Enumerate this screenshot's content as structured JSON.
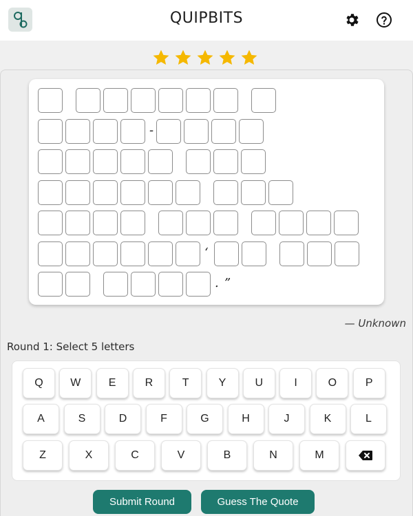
{
  "header": {
    "title": "QUIPBITS",
    "logo_icon": "qb-logo",
    "settings_icon": "gear-icon",
    "help_icon": "question-circle-icon"
  },
  "rating": {
    "stars_filled": 5,
    "stars_total": 5,
    "star_color": "#f5b800"
  },
  "quote": {
    "author": "— Unknown",
    "rows": [
      [
        1,
        6,
        1
      ],
      [
        4,
        "-",
        4
      ],
      [
        5,
        3
      ],
      [
        6,
        3
      ],
      [
        4,
        3,
        4
      ],
      [
        6,
        "‘",
        2,
        3
      ],
      [
        2,
        4,
        ".",
        "”"
      ]
    ]
  },
  "round": {
    "label": "Round 1: Select 5 letters"
  },
  "keyboard": {
    "rows": [
      [
        "Q",
        "W",
        "E",
        "R",
        "T",
        "Y",
        "U",
        "I",
        "O",
        "P"
      ],
      [
        "A",
        "S",
        "D",
        "F",
        "G",
        "H",
        "J",
        "K",
        "L"
      ],
      [
        "Z",
        "X",
        "C",
        "V",
        "B",
        "N",
        "M",
        "⌫"
      ]
    ]
  },
  "actions": {
    "submit_label": "Submit Round",
    "guess_label": "Guess The Quote"
  },
  "colors": {
    "accent": "#1e7a6f",
    "background": "#f0f0f0"
  }
}
